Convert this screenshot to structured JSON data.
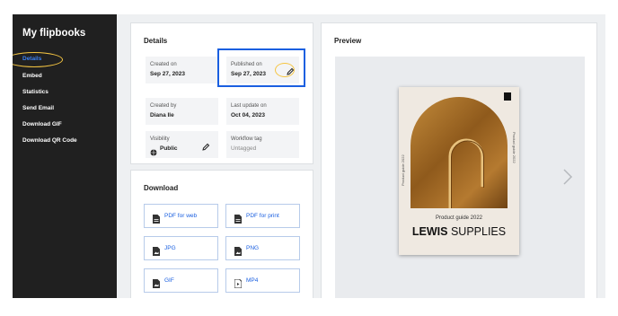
{
  "sidebar": {
    "title": "My flipbooks",
    "items": [
      {
        "label": "Details",
        "active": true
      },
      {
        "label": "Embed"
      },
      {
        "label": "Statistics"
      },
      {
        "label": "Send Email"
      },
      {
        "label": "Download GIF"
      },
      {
        "label": "Download QR Code"
      }
    ]
  },
  "details": {
    "heading": "Details",
    "created_on": {
      "label": "Created on",
      "value": "Sep 27, 2023"
    },
    "published_on": {
      "label": "Published on",
      "value": "Sep 27, 2023"
    },
    "created_by": {
      "label": "Created by",
      "value": "Diana Ile"
    },
    "last_update": {
      "label": "Last update on",
      "value": "Oct 04, 2023"
    },
    "visibility": {
      "label": "Visibility",
      "value": "Public"
    },
    "workflow": {
      "label": "Workflow tag",
      "value": "Untagged"
    }
  },
  "download": {
    "heading": "Download",
    "buttons": [
      "PDF for web",
      "PDF for print",
      "JPG",
      "PNG",
      "GIF",
      "MP4"
    ]
  },
  "preview": {
    "heading": "Preview",
    "cover_subtitle": "Product guide 2022",
    "cover_title_bold": "LEWIS",
    "cover_title_light": "SUPPLIES",
    "spine_text": "Product guide 2022"
  },
  "colors": {
    "sidebar_bg": "#202020",
    "accent_blue": "#1a5fe0",
    "highlight_yellow": "#f5c542",
    "active_item": "#3b82f6"
  }
}
